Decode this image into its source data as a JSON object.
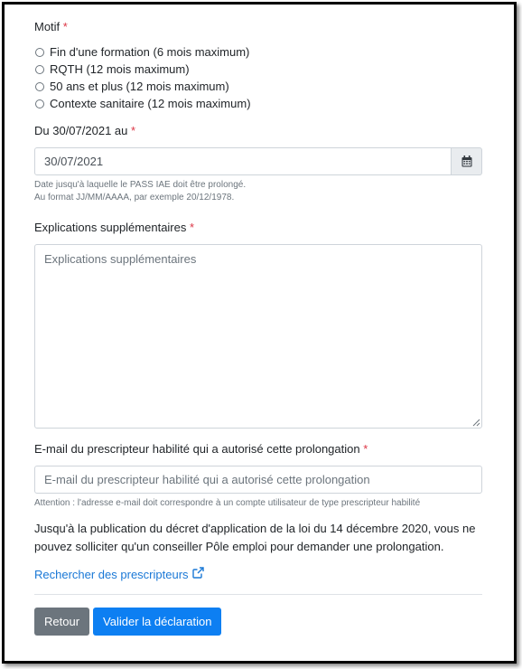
{
  "motif": {
    "label": "Motif",
    "required_mark": "*",
    "options": [
      "Fin d'une formation (6 mois maximum)",
      "RQTH (12 mois maximum)",
      "50 ans et plus (12 mois maximum)",
      "Contexte sanitaire (12 mois maximum)"
    ]
  },
  "date": {
    "label": "Du 30/07/2021 au",
    "required_mark": "*",
    "value": "30/07/2021",
    "calendar_icon": "calendar-icon",
    "help_line1": "Date jusqu'à laquelle le PASS IAE doit être prolongé.",
    "help_line2": "Au format JJ/MM/AAAA, par exemple 20/12/1978."
  },
  "explications": {
    "label": "Explications supplémentaires",
    "required_mark": "*",
    "placeholder": "Explications supplémentaires"
  },
  "email": {
    "label": "E-mail du prescripteur habilité qui a autorisé cette prolongation",
    "required_mark": "*",
    "placeholder": "E-mail du prescripteur habilité qui a autorisé cette prolongation",
    "help": "Attention : l'adresse e-mail doit correspondre à un compte utilisateur de type prescripteur habilité"
  },
  "notice": {
    "line1": "Jusqu'à la publication du décret d'application de la loi du 14 décembre 2020, vous ne",
    "line2": "pouvez solliciter qu'un conseiller Pôle emploi pour demander une prolongation."
  },
  "link": {
    "text": "Rechercher des prescripteurs",
    "icon": "external-link-icon"
  },
  "buttons": {
    "back": "Retour",
    "submit": "Valider la déclaration"
  },
  "colors": {
    "primary": "#0d7ff2",
    "secondary": "#6c757d",
    "required": "#dc3545",
    "link": "#1a78d6"
  }
}
